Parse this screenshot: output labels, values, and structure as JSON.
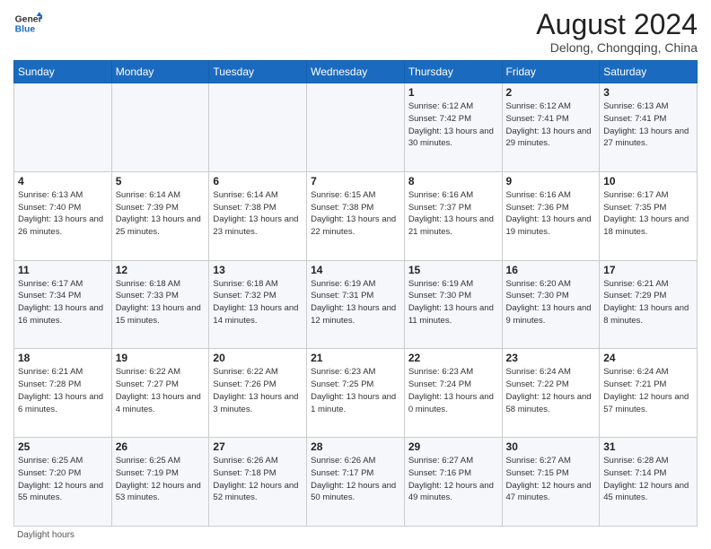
{
  "header": {
    "logo_line1": "General",
    "logo_line2": "Blue",
    "main_title": "August 2024",
    "subtitle": "Delong, Chongqing, China"
  },
  "calendar": {
    "days_of_week": [
      "Sunday",
      "Monday",
      "Tuesday",
      "Wednesday",
      "Thursday",
      "Friday",
      "Saturday"
    ],
    "weeks": [
      [
        {
          "day": "",
          "info": ""
        },
        {
          "day": "",
          "info": ""
        },
        {
          "day": "",
          "info": ""
        },
        {
          "day": "",
          "info": ""
        },
        {
          "day": "1",
          "info": "Sunrise: 6:12 AM\nSunset: 7:42 PM\nDaylight: 13 hours and 30 minutes."
        },
        {
          "day": "2",
          "info": "Sunrise: 6:12 AM\nSunset: 7:41 PM\nDaylight: 13 hours and 29 minutes."
        },
        {
          "day": "3",
          "info": "Sunrise: 6:13 AM\nSunset: 7:41 PM\nDaylight: 13 hours and 27 minutes."
        }
      ],
      [
        {
          "day": "4",
          "info": "Sunrise: 6:13 AM\nSunset: 7:40 PM\nDaylight: 13 hours and 26 minutes."
        },
        {
          "day": "5",
          "info": "Sunrise: 6:14 AM\nSunset: 7:39 PM\nDaylight: 13 hours and 25 minutes."
        },
        {
          "day": "6",
          "info": "Sunrise: 6:14 AM\nSunset: 7:38 PM\nDaylight: 13 hours and 23 minutes."
        },
        {
          "day": "7",
          "info": "Sunrise: 6:15 AM\nSunset: 7:38 PM\nDaylight: 13 hours and 22 minutes."
        },
        {
          "day": "8",
          "info": "Sunrise: 6:16 AM\nSunset: 7:37 PM\nDaylight: 13 hours and 21 minutes."
        },
        {
          "day": "9",
          "info": "Sunrise: 6:16 AM\nSunset: 7:36 PM\nDaylight: 13 hours and 19 minutes."
        },
        {
          "day": "10",
          "info": "Sunrise: 6:17 AM\nSunset: 7:35 PM\nDaylight: 13 hours and 18 minutes."
        }
      ],
      [
        {
          "day": "11",
          "info": "Sunrise: 6:17 AM\nSunset: 7:34 PM\nDaylight: 13 hours and 16 minutes."
        },
        {
          "day": "12",
          "info": "Sunrise: 6:18 AM\nSunset: 7:33 PM\nDaylight: 13 hours and 15 minutes."
        },
        {
          "day": "13",
          "info": "Sunrise: 6:18 AM\nSunset: 7:32 PM\nDaylight: 13 hours and 14 minutes."
        },
        {
          "day": "14",
          "info": "Sunrise: 6:19 AM\nSunset: 7:31 PM\nDaylight: 13 hours and 12 minutes."
        },
        {
          "day": "15",
          "info": "Sunrise: 6:19 AM\nSunset: 7:30 PM\nDaylight: 13 hours and 11 minutes."
        },
        {
          "day": "16",
          "info": "Sunrise: 6:20 AM\nSunset: 7:30 PM\nDaylight: 13 hours and 9 minutes."
        },
        {
          "day": "17",
          "info": "Sunrise: 6:21 AM\nSunset: 7:29 PM\nDaylight: 13 hours and 8 minutes."
        }
      ],
      [
        {
          "day": "18",
          "info": "Sunrise: 6:21 AM\nSunset: 7:28 PM\nDaylight: 13 hours and 6 minutes."
        },
        {
          "day": "19",
          "info": "Sunrise: 6:22 AM\nSunset: 7:27 PM\nDaylight: 13 hours and 4 minutes."
        },
        {
          "day": "20",
          "info": "Sunrise: 6:22 AM\nSunset: 7:26 PM\nDaylight: 13 hours and 3 minutes."
        },
        {
          "day": "21",
          "info": "Sunrise: 6:23 AM\nSunset: 7:25 PM\nDaylight: 13 hours and 1 minute."
        },
        {
          "day": "22",
          "info": "Sunrise: 6:23 AM\nSunset: 7:24 PM\nDaylight: 13 hours and 0 minutes."
        },
        {
          "day": "23",
          "info": "Sunrise: 6:24 AM\nSunset: 7:22 PM\nDaylight: 12 hours and 58 minutes."
        },
        {
          "day": "24",
          "info": "Sunrise: 6:24 AM\nSunset: 7:21 PM\nDaylight: 12 hours and 57 minutes."
        }
      ],
      [
        {
          "day": "25",
          "info": "Sunrise: 6:25 AM\nSunset: 7:20 PM\nDaylight: 12 hours and 55 minutes."
        },
        {
          "day": "26",
          "info": "Sunrise: 6:25 AM\nSunset: 7:19 PM\nDaylight: 12 hours and 53 minutes."
        },
        {
          "day": "27",
          "info": "Sunrise: 6:26 AM\nSunset: 7:18 PM\nDaylight: 12 hours and 52 minutes."
        },
        {
          "day": "28",
          "info": "Sunrise: 6:26 AM\nSunset: 7:17 PM\nDaylight: 12 hours and 50 minutes."
        },
        {
          "day": "29",
          "info": "Sunrise: 6:27 AM\nSunset: 7:16 PM\nDaylight: 12 hours and 49 minutes."
        },
        {
          "day": "30",
          "info": "Sunrise: 6:27 AM\nSunset: 7:15 PM\nDaylight: 12 hours and 47 minutes."
        },
        {
          "day": "31",
          "info": "Sunrise: 6:28 AM\nSunset: 7:14 PM\nDaylight: 12 hours and 45 minutes."
        }
      ]
    ]
  },
  "footer": {
    "note": "Daylight hours"
  }
}
